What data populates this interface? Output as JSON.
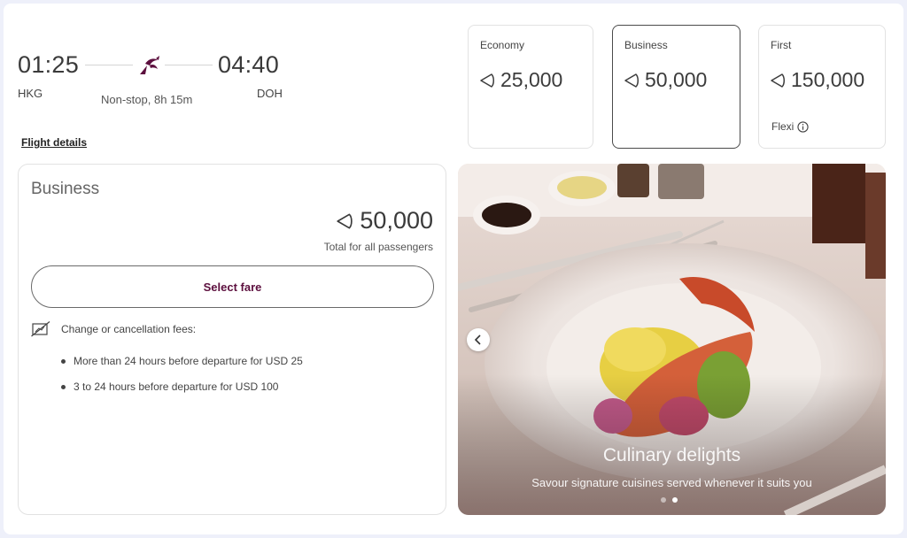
{
  "flight": {
    "departure_time": "01:25",
    "arrival_time": "04:40",
    "origin": "HKG",
    "destination": "DOH",
    "duration": "Non-stop, 8h 15m",
    "details_link": "Flight details"
  },
  "fares": [
    {
      "name": "Economy",
      "price": "25,000"
    },
    {
      "name": "Business",
      "price": "50,000"
    },
    {
      "name": "First",
      "price": "150,000",
      "tag": "Flexi"
    }
  ],
  "selected_fare": {
    "name": "Business",
    "price": "50,000",
    "total_label": "Total for all passengers",
    "select_button": "Select fare",
    "fees_heading": "Change or cancellation fees:",
    "fees": [
      "More than 24 hours before departure for USD 25",
      "3 to 24 hours before departure for USD 100"
    ]
  },
  "carousel": {
    "title": "Culinary delights",
    "subtitle": "Savour signature cuisines served whenever it suits you",
    "slide_count": 2,
    "active_slide": 2
  },
  "icons": {
    "airline_logo": "oryx-logo-icon",
    "currency": "avios-icon",
    "info": "info-icon",
    "fees": "no-fee-icon",
    "prev": "chevron-left-icon"
  },
  "colors": {
    "brand": "#5c0f3e",
    "selected_border": "#4a4a4a"
  }
}
